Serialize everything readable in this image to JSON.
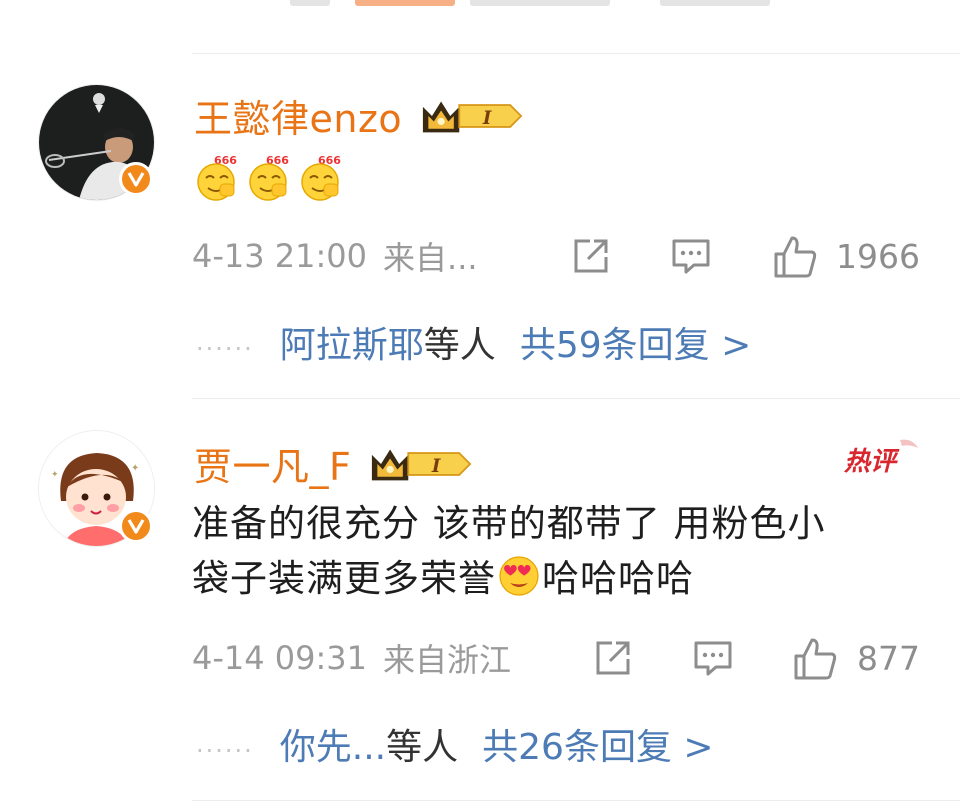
{
  "comments": [
    {
      "username": "王懿律enzo",
      "badge_level": "I",
      "content_emoji": [
        "666-emoji",
        "666-emoji",
        "666-emoji"
      ],
      "time": "4-13 21:00",
      "source": "来自...",
      "likes": "1966",
      "reply_names": "阿拉斯耶",
      "reply_etc": "等人",
      "reply_total": "共59条回复 >"
    },
    {
      "username": "贾一凡_F",
      "badge_level": "I",
      "hot_label": "热评",
      "text_line1": "准备的很充分 该带的都带了 用粉色小",
      "text_line2_a": "袋子装满更多荣誉",
      "text_line2_b": "哈哈哈哈",
      "inline_emoji": "heart-eyes-emoji",
      "time": "4-14 09:31",
      "source": "来自浙江",
      "likes": "877",
      "reply_names": "你先...",
      "reply_etc": "等人",
      "reply_total": "共26条回复 >"
    }
  ],
  "reply_dots": "......",
  "colors": {
    "username": "#e97416",
    "link": "#4d7bb5",
    "meta": "#9a9a9a",
    "verified_badge": "#f28a1b",
    "hot_tag": "#d8272e"
  },
  "icons": [
    "share-icon",
    "comment-icon",
    "like-icon",
    "verified-v-icon",
    "crown-badge-icon"
  ]
}
